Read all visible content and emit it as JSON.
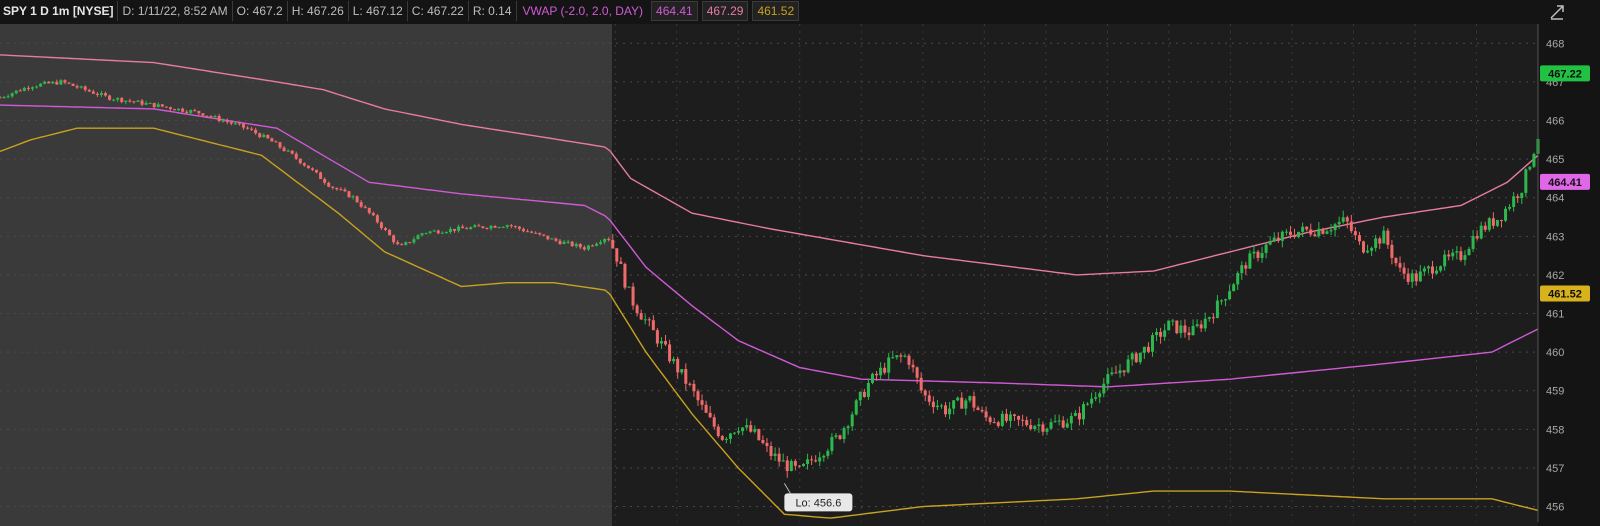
{
  "header": {
    "symbol": "SPY 1 D 1m [NYSE]",
    "date": "D: 1/11/22, 8:52 AM",
    "open": "O: 467.2",
    "high": "H: 467.26",
    "low": "L: 467.12",
    "close": "C: 467.22",
    "range": "R: 0.14",
    "vwap_label": "VWAP (-2.0, 2.0, DAY)",
    "vwap_value": "464.41",
    "upper_value": "467.29",
    "lower_value": "461.52"
  },
  "colors": {
    "premarket_bg": "#3a3a3a",
    "session_bg": "#1d1d1d",
    "up": "#2db84d",
    "down": "#f06a6a",
    "vwap": "#d05ad5",
    "upper_band": "#e87aa6",
    "lower_band": "#c9a21f",
    "price_tag": "#21c244"
  },
  "chart_data": {
    "type": "candlestick",
    "ylim": [
      455.6,
      468.5
    ],
    "yticks": [
      "468",
      "467",
      "466",
      "465",
      "464",
      "463",
      "462",
      "461",
      "460",
      "459",
      "458",
      "457",
      "456"
    ],
    "price_tags": [
      {
        "label": "467.22",
        "value": 467.22,
        "color": "#21c244"
      },
      {
        "label": "464.41",
        "value": 464.41,
        "color": "#e067e8"
      },
      {
        "label": "461.52",
        "value": 461.52,
        "color": "#d8b21c"
      }
    ],
    "low_marker": {
      "label": "Lo: 456.6",
      "value": 456.6
    },
    "premarket_fraction": 0.398,
    "path": [
      [
        0,
        466.6
      ],
      [
        0.02,
        466.9
      ],
      [
        0.04,
        467
      ],
      [
        0.07,
        466.6
      ],
      [
        0.1,
        466.4
      ],
      [
        0.13,
        466.2
      ],
      [
        0.16,
        465.8
      ],
      [
        0.175,
        465.5
      ],
      [
        0.19,
        465.1
      ],
      [
        0.2,
        464.8
      ],
      [
        0.215,
        464.3
      ],
      [
        0.23,
        464
      ],
      [
        0.245,
        463.4
      ],
      [
        0.26,
        462.7
      ],
      [
        0.275,
        463.1
      ],
      [
        0.3,
        463.2
      ],
      [
        0.33,
        463.3
      ],
      [
        0.345,
        463.1
      ],
      [
        0.36,
        462.9
      ],
      [
        0.38,
        462.7
      ],
      [
        0.395,
        463
      ],
      [
        0.4,
        462.6
      ],
      [
        0.41,
        461.4
      ],
      [
        0.42,
        460.8
      ],
      [
        0.43,
        460.2
      ],
      [
        0.44,
        459.6
      ],
      [
        0.45,
        459
      ],
      [
        0.46,
        458.3
      ],
      [
        0.47,
        457.8
      ],
      [
        0.48,
        458.1
      ],
      [
        0.49,
        457.9
      ],
      [
        0.5,
        457.4
      ],
      [
        0.51,
        457.1
      ],
      [
        0.52,
        456.9
      ],
      [
        0.53,
        457.3
      ],
      [
        0.545,
        457.8
      ],
      [
        0.555,
        458.5
      ],
      [
        0.565,
        459.2
      ],
      [
        0.58,
        459.8
      ],
      [
        0.59,
        459.9
      ],
      [
        0.6,
        458.9
      ],
      [
        0.615,
        458.5
      ],
      [
        0.63,
        458.8
      ],
      [
        0.64,
        458.3
      ],
      [
        0.66,
        458.2
      ],
      [
        0.68,
        458.1
      ],
      [
        0.7,
        458.3
      ],
      [
        0.715,
        459.1
      ],
      [
        0.73,
        459.6
      ],
      [
        0.745,
        460.1
      ],
      [
        0.76,
        460.7
      ],
      [
        0.775,
        460.5
      ],
      [
        0.79,
        461.1
      ],
      [
        0.8,
        461.7
      ],
      [
        0.81,
        462.3
      ],
      [
        0.825,
        462.8
      ],
      [
        0.84,
        463.1
      ],
      [
        0.86,
        463.2
      ],
      [
        0.875,
        463.4
      ],
      [
        0.885,
        462.7
      ],
      [
        0.9,
        463
      ],
      [
        0.91,
        462.1
      ],
      [
        0.92,
        461.9
      ],
      [
        0.935,
        462.3
      ],
      [
        0.95,
        462.5
      ],
      [
        0.96,
        463.1
      ],
      [
        0.975,
        463.5
      ],
      [
        0.99,
        464.3
      ],
      [
        1,
        465.6
      ]
    ],
    "vwap_path": [
      [
        0,
        466.4
      ],
      [
        0.1,
        466.3
      ],
      [
        0.18,
        465.8
      ],
      [
        0.21,
        465.1
      ],
      [
        0.24,
        464.4
      ],
      [
        0.3,
        464.1
      ],
      [
        0.38,
        463.8
      ],
      [
        0.395,
        463.5
      ],
      [
        0.42,
        462.2
      ],
      [
        0.45,
        461.2
      ],
      [
        0.48,
        460.3
      ],
      [
        0.52,
        459.6
      ],
      [
        0.56,
        459.3
      ],
      [
        0.65,
        459.2
      ],
      [
        0.72,
        459.1
      ],
      [
        0.8,
        459.3
      ],
      [
        0.9,
        459.7
      ],
      [
        0.97,
        460
      ],
      [
        1,
        460.6
      ]
    ],
    "upper_path": [
      [
        0,
        467.7
      ],
      [
        0.1,
        467.5
      ],
      [
        0.18,
        467
      ],
      [
        0.21,
        466.8
      ],
      [
        0.25,
        466.3
      ],
      [
        0.3,
        465.9
      ],
      [
        0.38,
        465.4
      ],
      [
        0.395,
        465.3
      ],
      [
        0.41,
        464.5
      ],
      [
        0.45,
        463.6
      ],
      [
        0.5,
        463.2
      ],
      [
        0.6,
        462.5
      ],
      [
        0.7,
        462
      ],
      [
        0.75,
        462.1
      ],
      [
        0.8,
        462.6
      ],
      [
        0.85,
        463.1
      ],
      [
        0.9,
        463.5
      ],
      [
        0.95,
        463.8
      ],
      [
        0.98,
        464.4
      ],
      [
        1,
        465.1
      ]
    ],
    "lower_path": [
      [
        0,
        465.2
      ],
      [
        0.02,
        465.5
      ],
      [
        0.05,
        465.8
      ],
      [
        0.1,
        465.8
      ],
      [
        0.17,
        465.1
      ],
      [
        0.2,
        464.2
      ],
      [
        0.22,
        463.6
      ],
      [
        0.25,
        462.6
      ],
      [
        0.3,
        461.7
      ],
      [
        0.33,
        461.8
      ],
      [
        0.36,
        461.8
      ],
      [
        0.395,
        461.6
      ],
      [
        0.42,
        460
      ],
      [
        0.45,
        458.4
      ],
      [
        0.48,
        457
      ],
      [
        0.51,
        455.8
      ],
      [
        0.54,
        455.7
      ],
      [
        0.6,
        456
      ],
      [
        0.7,
        456.2
      ],
      [
        0.75,
        456.4
      ],
      [
        0.8,
        456.4
      ],
      [
        0.9,
        456.2
      ],
      [
        0.97,
        456.2
      ],
      [
        1,
        455.9
      ]
    ]
  }
}
